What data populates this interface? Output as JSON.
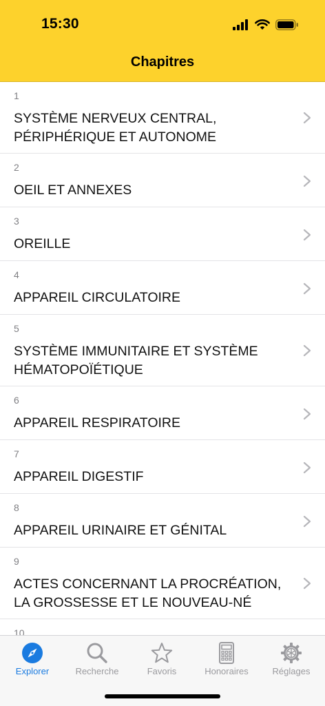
{
  "status_bar": {
    "time": "15:30"
  },
  "header": {
    "title": "Chapitres"
  },
  "chapters": [
    {
      "number": "1",
      "lines": [
        "SYSTÈME NERVEUX CENTRAL,",
        "PÉRIPHÉRIQUE ET AUTONOME"
      ]
    },
    {
      "number": "2",
      "lines": [
        "OEIL ET ANNEXES"
      ]
    },
    {
      "number": "3",
      "lines": [
        "OREILLE"
      ]
    },
    {
      "number": "4",
      "lines": [
        "APPAREIL CIRCULATOIRE"
      ]
    },
    {
      "number": "5",
      "lines": [
        "SYSTÈME IMMUNITAIRE ET SYSTÈME",
        "HÉMATOPOÏÉTIQUE"
      ]
    },
    {
      "number": "6",
      "lines": [
        "APPAREIL RESPIRATOIRE"
      ]
    },
    {
      "number": "7",
      "lines": [
        "APPAREIL DIGESTIF"
      ]
    },
    {
      "number": "8",
      "lines": [
        "APPAREIL URINAIRE ET GÉNITAL"
      ]
    },
    {
      "number": "9",
      "lines": [
        "ACTES CONCERNANT LA PROCRÉATION,",
        "LA GROSSESSE ET LE NOUVEAU-NÉ"
      ]
    },
    {
      "number": "10",
      "lines": [
        ""
      ]
    }
  ],
  "tabbar": {
    "items": [
      {
        "label": "Explorer",
        "icon": "compass-icon",
        "active": true
      },
      {
        "label": "Recherche",
        "icon": "search-icon",
        "active": false
      },
      {
        "label": "Favoris",
        "icon": "star-icon",
        "active": false
      },
      {
        "label": "Honoraires",
        "icon": "calculator-icon",
        "active": false
      },
      {
        "label": "Réglages",
        "icon": "gear-icon",
        "active": false
      }
    ]
  },
  "colors": {
    "header": "#FDD22C",
    "active_tab": "#1a7be0",
    "inactive_tab": "#9a9a9e"
  }
}
